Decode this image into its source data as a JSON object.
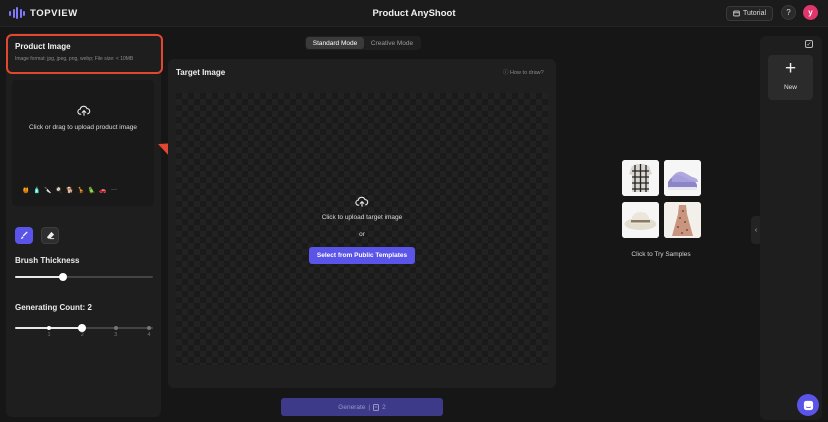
{
  "header": {
    "logo_text": "TOPVIEW",
    "title": "Product AnyShoot",
    "tutorial_label": "Tutorial",
    "help_label": "?",
    "avatar_initial": "y"
  },
  "left_panel": {
    "product_title": "Product Image",
    "product_subtitle": "Image format: jpg, jpeg, png, webp; File size: < 10MB",
    "upload_label": "Click or drag to upload product image",
    "emoji_icons": [
      "🍯",
      "🧴",
      "🔪",
      "🍳",
      "🐕",
      "🦒",
      "🦜",
      "🚗",
      "···"
    ],
    "brush_thickness_label": "Brush Thickness",
    "brush_thickness_value": 0.35,
    "generating_count_label": "Generating Count: 2",
    "count_steps": [
      "1",
      "2",
      "3",
      "4"
    ],
    "count_value": 2
  },
  "mode_toggle": {
    "standard": "Standard Mode",
    "creative": "Creative Mode",
    "active": "standard"
  },
  "target": {
    "title": "Target Image",
    "how_to": "ⓘ How to draw?",
    "upload_label": "Click to upload target image",
    "or_label": "or",
    "template_button": "Select from Public Templates"
  },
  "generate": {
    "label": "Generate",
    "credits": "2"
  },
  "samples": {
    "label": "Click to Try Samples"
  },
  "right_sidebar": {
    "new_label": "New",
    "new_icon": "+"
  },
  "colors": {
    "accent": "#5b54e8",
    "highlight": "#e4472f",
    "avatar": "#e0366b"
  }
}
